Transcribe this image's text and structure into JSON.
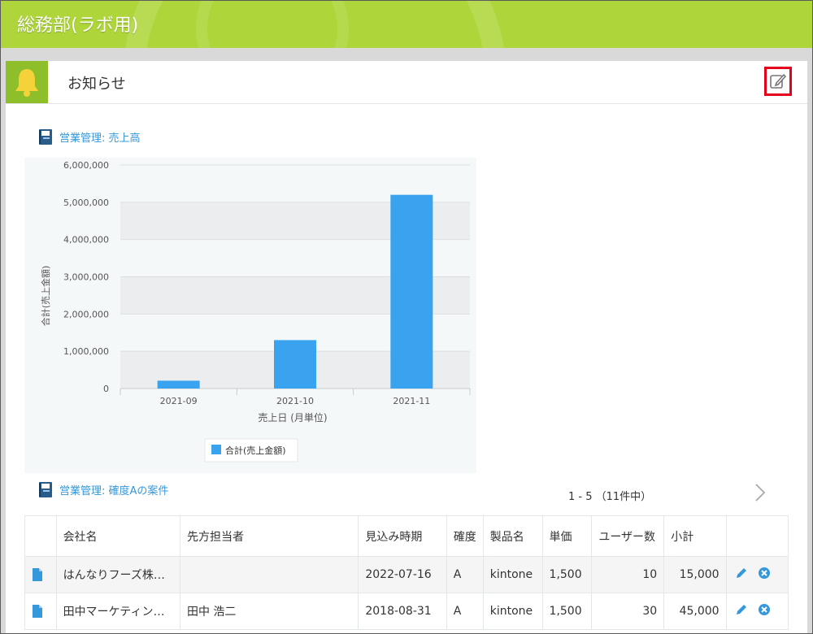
{
  "header": {
    "space_title": "総務部(ラボ用)"
  },
  "notice": {
    "title": "お知らせ"
  },
  "report1": {
    "title": "営業管理: 売上高"
  },
  "chart_data": {
    "type": "bar",
    "categories": [
      "2021-09",
      "2021-10",
      "2021-11"
    ],
    "series": [
      {
        "name": "合計(売上金額)",
        "values": [
          210000,
          1300000,
          5200000
        ],
        "color": "#3aa3f0"
      }
    ],
    "xlabel": "売上日 (月単位)",
    "ylabel": "合計(売上金額)",
    "ylim": [
      0,
      6000000
    ],
    "yticks": [
      "0",
      "1,000,000",
      "2,000,000",
      "3,000,000",
      "4,000,000",
      "5,000,000",
      "6,000,000"
    ],
    "grid": true,
    "legend": "bottom"
  },
  "report2": {
    "title": "営業管理: 確度Aの案件"
  },
  "pager": {
    "text": "1 - 5 （11件中）"
  },
  "table": {
    "columns": [
      "会社名",
      "先方担当者",
      "見込み時期",
      "確度",
      "製品名",
      "単価",
      "ユーザー数",
      "小計"
    ],
    "rows": [
      {
        "company": "はんなりフーズ株…",
        "contact": "",
        "date": "2022-07-16",
        "rank": "A",
        "product": "kintone",
        "price": "1,500",
        "users": "10",
        "subtotal": "15,000"
      },
      {
        "company": "田中マーケティン…",
        "contact": "田中 浩二",
        "date": "2018-08-31",
        "rank": "A",
        "product": "kintone",
        "price": "1,500",
        "users": "30",
        "subtotal": "45,000"
      }
    ]
  },
  "colors": {
    "topbar": "#aed63a",
    "accent": "#3498db",
    "bar": "#3aa3f0",
    "edit_highlight": "#e5001b"
  },
  "icons": {
    "notice": "bell-icon",
    "edit": "edit-note-icon",
    "report": "report-book-icon",
    "record": "document-icon",
    "row_edit": "pencil-icon",
    "row_delete": "delete-icon",
    "next": "chevron-right-icon"
  }
}
